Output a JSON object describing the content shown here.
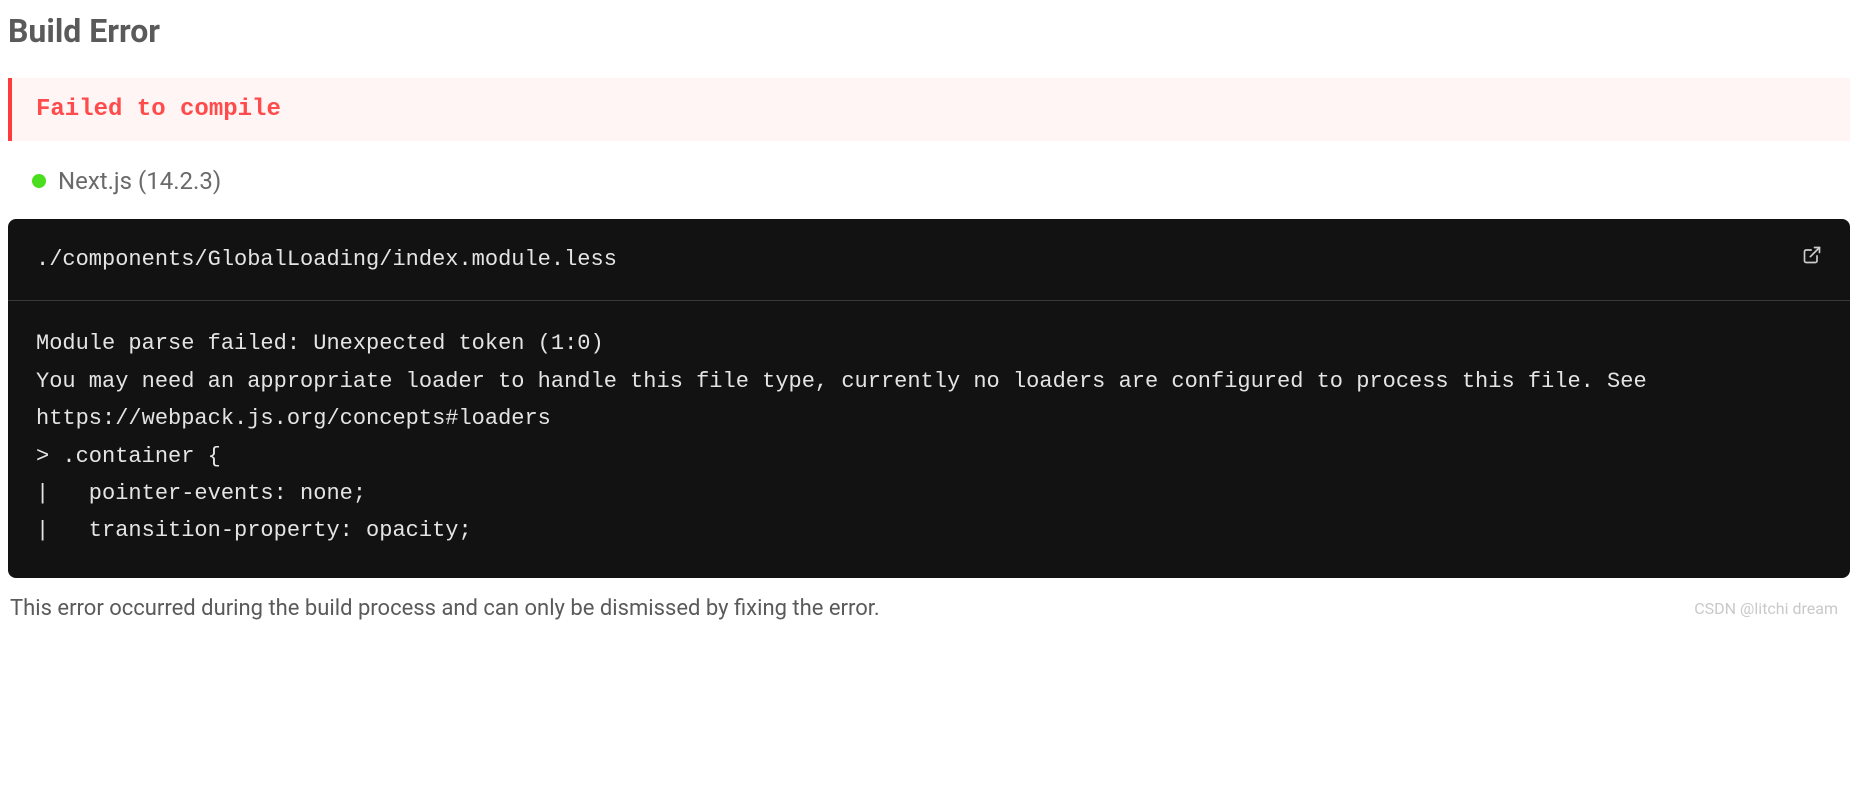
{
  "header": {
    "title": "Build Error"
  },
  "banner": {
    "message": "Failed to compile"
  },
  "framework": {
    "name": "Next.js (14.2.3)"
  },
  "code": {
    "file_path": "./components/GlobalLoading/index.module.less",
    "body": "Module parse failed: Unexpected token (1:0)\nYou may need an appropriate loader to handle this file type, currently no loaders are configured to process this file. See https://webpack.js.org/concepts#loaders\n> .container {\n|   pointer-events: none;\n|   transition-property: opacity;"
  },
  "footer": {
    "note": "This error occurred during the build process and can only be dismissed by fixing the error."
  },
  "watermark": {
    "text": "CSDN @litchi dream"
  }
}
